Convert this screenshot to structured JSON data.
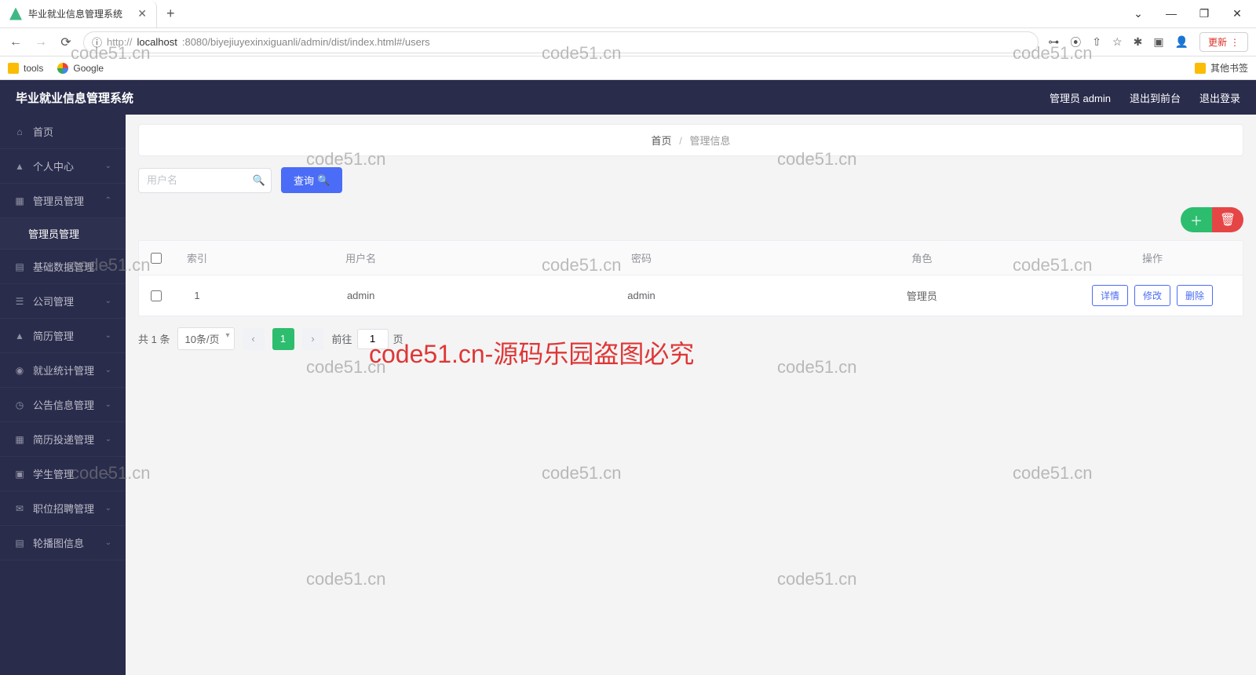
{
  "browser": {
    "tab_title": "毕业就业信息管理系统",
    "new_tab": "+",
    "close": "✕",
    "nav_back": "←",
    "nav_forward": "→",
    "nav_reload": "⟳",
    "url_icon": "ⓘ",
    "url_prefix": "http://",
    "url_host": "localhost",
    "url_rest": ":8080/biyejiuyexinxiguanli/admin/dist/index.html#/users",
    "key_icon": "⊶",
    "translate_icon": "⦿",
    "share_icon": "⇧",
    "star_label": "☆",
    "ext_icon": "✱",
    "panel_icon": "▣",
    "profile_icon": "👤",
    "update_label": "更新",
    "update_dots": "⋮",
    "win_down": "⌄",
    "win_min": "—",
    "win_max": "❐",
    "win_close": "✕"
  },
  "bookmarks": {
    "tools": "tools",
    "google": "Google",
    "other": "其他书签"
  },
  "header": {
    "title": "毕业就业信息管理系统",
    "admin_label": "管理员 admin",
    "to_front": "退出到前台",
    "logout": "退出登录"
  },
  "sidebar": {
    "items": [
      {
        "icon": "⌂",
        "label": "首页",
        "arrow": ""
      },
      {
        "icon": "▲",
        "label": "个人中心",
        "arrow": "⌄"
      },
      {
        "icon": "▦",
        "label": "管理员管理",
        "arrow": "⌃"
      },
      {
        "icon": "",
        "label": "管理员管理",
        "arrow": "",
        "sub": true
      },
      {
        "icon": "▤",
        "label": "基础数据管理",
        "arrow": "⌄"
      },
      {
        "icon": "☰",
        "label": "公司管理",
        "arrow": "⌄"
      },
      {
        "icon": "▲",
        "label": "简历管理",
        "arrow": "⌄"
      },
      {
        "icon": "◉",
        "label": "就业统计管理",
        "arrow": "⌄"
      },
      {
        "icon": "◷",
        "label": "公告信息管理",
        "arrow": "⌄"
      },
      {
        "icon": "▦",
        "label": "简历投递管理",
        "arrow": "⌄"
      },
      {
        "icon": "▣",
        "label": "学生管理",
        "arrow": "⌄"
      },
      {
        "icon": "✉",
        "label": "职位招聘管理",
        "arrow": "⌄"
      },
      {
        "icon": "▤",
        "label": "轮播图信息",
        "arrow": "⌄"
      }
    ]
  },
  "breadcrumb": {
    "home": "首页",
    "sep": "/",
    "current": "管理信息"
  },
  "search": {
    "placeholder": "用户名",
    "button": "查询"
  },
  "table": {
    "headers": {
      "index": "索引",
      "username": "用户名",
      "password": "密码",
      "role": "角色",
      "ops": "操作"
    },
    "rows": [
      {
        "index": "1",
        "username": "admin",
        "password": "admin",
        "role": "管理员"
      }
    ],
    "ops": {
      "detail": "详情",
      "edit": "修改",
      "delete": "删除"
    }
  },
  "pagination": {
    "total": "共 1 条",
    "page_size": "10条/页",
    "current": "1",
    "jump_prefix": "前往",
    "jump_value": "1",
    "jump_suffix": "页"
  },
  "watermarks": {
    "w1": "code51.cn",
    "big": "code51.cn-源码乐园盗图必究"
  }
}
